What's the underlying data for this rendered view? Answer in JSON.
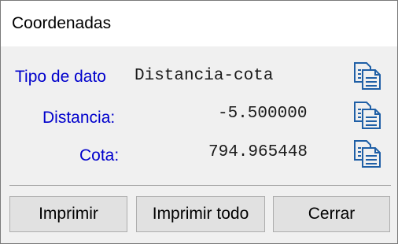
{
  "window": {
    "title": "Coordenadas"
  },
  "fields": [
    {
      "label": "Tipo de dato",
      "value": "Distancia-cota",
      "icon": "copy-icon"
    },
    {
      "label": "Distancia:",
      "value": "-5.500000",
      "icon": "copy-icon"
    },
    {
      "label": "Cota:",
      "value": "794.965448",
      "icon": "copy-icon"
    }
  ],
  "buttons": {
    "print": "Imprimir",
    "print_all": "Imprimir todo",
    "close": "Cerrar"
  },
  "colors": {
    "label": "#0000cc",
    "icon": "#1f5fa6"
  }
}
